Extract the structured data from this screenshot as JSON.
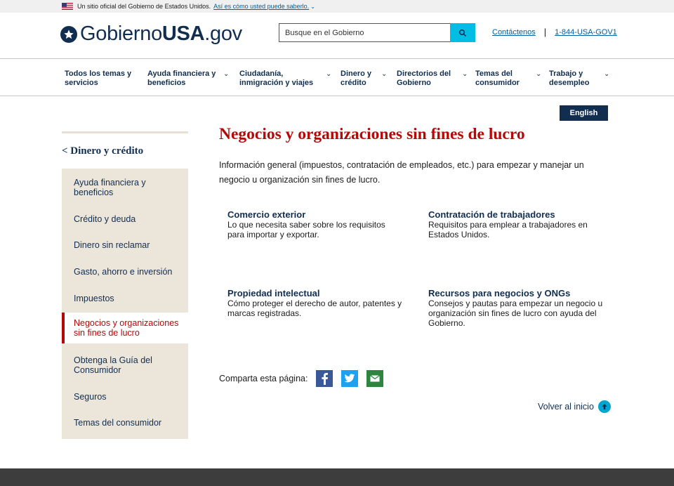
{
  "gov_banner": {
    "text": "Un sitio oficial del Gobierno de Estados Unidos.",
    "link": "Así es cómo usted puede saberlo."
  },
  "header": {
    "logo_regular": "Gobierno",
    "logo_bold": "USA",
    "logo_suffix": ".gov",
    "search_placeholder": "Busque en el Gobierno",
    "contact_link": "Contáctenos",
    "phone_link": "1-844-USA-GOV1"
  },
  "nav": {
    "items": [
      {
        "label": "Todos los temas y servicios"
      },
      {
        "label": "Ayuda financiera y beneficios"
      },
      {
        "label": "Ciudadanía, inmigración y viajes"
      },
      {
        "label": "Dinero y crédito"
      },
      {
        "label": "Directorios del Gobierno"
      },
      {
        "label": "Temas del consumidor"
      },
      {
        "label": "Trabajo y desempleo"
      }
    ]
  },
  "lang_button": "English",
  "sidebar": {
    "back_link": "< Dinero y crédito",
    "items": [
      {
        "label": "Ayuda financiera y beneficios",
        "active": false
      },
      {
        "label": "Crédito y deuda",
        "active": false
      },
      {
        "label": "Dinero sin reclamar",
        "active": false
      },
      {
        "label": "Gasto, ahorro e inversión",
        "active": false
      },
      {
        "label": "Impuestos",
        "active": false
      },
      {
        "label": "Negocios y organizaciones sin fines de lucro",
        "active": true
      },
      {
        "label": "Obtenga la Guía del Consumidor",
        "active": false
      },
      {
        "label": "Seguros",
        "active": false
      },
      {
        "label": "Temas del consumidor",
        "active": false
      }
    ]
  },
  "main": {
    "title": "Negocios y organizaciones sin fines de lucro",
    "intro": "Información general (impuestos, contratación de empleados, etc.) para empezar y manejar un negocio u organización sin fines de lucro.",
    "topics": [
      {
        "title": "Comercio exterior",
        "desc": "Lo que necesita saber sobre los requisitos para importar y exportar."
      },
      {
        "title": "Contratación de trabajadores",
        "desc": "Requisitos para emplear a trabajadores en Estados Unidos."
      },
      {
        "title": "Propiedad intelectual",
        "desc": "Cómo proteger el derecho de autor, patentes y marcas registradas."
      },
      {
        "title": "Recursos para negocios y ONGs",
        "desc": "Consejos y pautas para empezar un negocio u organización sin fines de lucro con ayuda del Gobierno."
      }
    ],
    "share_label": "Comparta esta página:",
    "back_to_top": "Volver al inicio"
  },
  "colors": {
    "navy": "#112e51",
    "red": "#b50909",
    "cyan": "#00bde3",
    "sidebar_bg": "#ece5da",
    "footer": "#3d3d3d"
  }
}
